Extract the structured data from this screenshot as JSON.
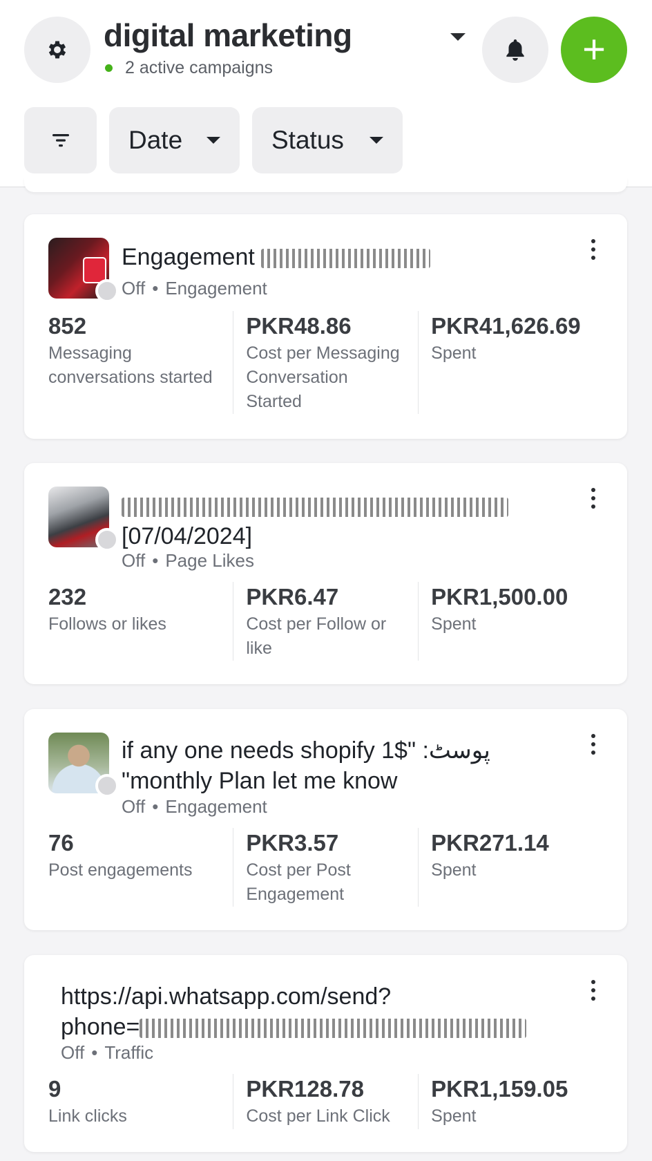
{
  "header": {
    "title": "digital marketing",
    "subtitle": "2 active campaigns",
    "add_label": "+"
  },
  "filters": {
    "date": "Date",
    "status": "Status"
  },
  "campaigns": [
    {
      "name": "Engagement",
      "name_line2": "",
      "status": "Off",
      "objective": "Engagement",
      "metrics": [
        {
          "value": "852",
          "label": "Messaging conversations started"
        },
        {
          "value": "PKR48.86",
          "label": "Cost per Messaging Conversation Started"
        },
        {
          "value": "PKR41,626.69",
          "label": "Spent"
        }
      ]
    },
    {
      "name": "",
      "name_line2": "[07/04/2024]",
      "status": "Off",
      "objective": "Page Likes",
      "metrics": [
        {
          "value": "232",
          "label": "Follows or likes"
        },
        {
          "value": "PKR6.47",
          "label": "Cost per Follow or like"
        },
        {
          "value": "PKR1,500.00",
          "label": "Spent"
        }
      ]
    },
    {
      "name": "if any one needs shopify 1$\" :پوسٹ",
      "name_line2": "\"monthly Plan let me know",
      "status": "Off",
      "objective": "Engagement",
      "metrics": [
        {
          "value": "76",
          "label": "Post engagements"
        },
        {
          "value": "PKR3.57",
          "label": "Cost per Post Engagement"
        },
        {
          "value": "PKR271.14",
          "label": "Spent"
        }
      ]
    },
    {
      "name": "https://api.whatsapp.com/send?",
      "name_line2": "phone=",
      "status": "Off",
      "objective": "Traffic",
      "metrics": [
        {
          "value": "9",
          "label": "Link clicks"
        },
        {
          "value": "PKR128.78",
          "label": "Cost per Link Click"
        },
        {
          "value": "PKR1,159.05",
          "label": "Spent"
        }
      ]
    }
  ],
  "icons": {
    "settings": "gear-icon",
    "notifications": "bell-icon",
    "filter": "filter-icon",
    "more": "more-vertical-icon"
  },
  "colors": {
    "accent": "#5cbd1f",
    "active_dot": "#45b21a",
    "inactive_dot": "#d8d8db"
  }
}
